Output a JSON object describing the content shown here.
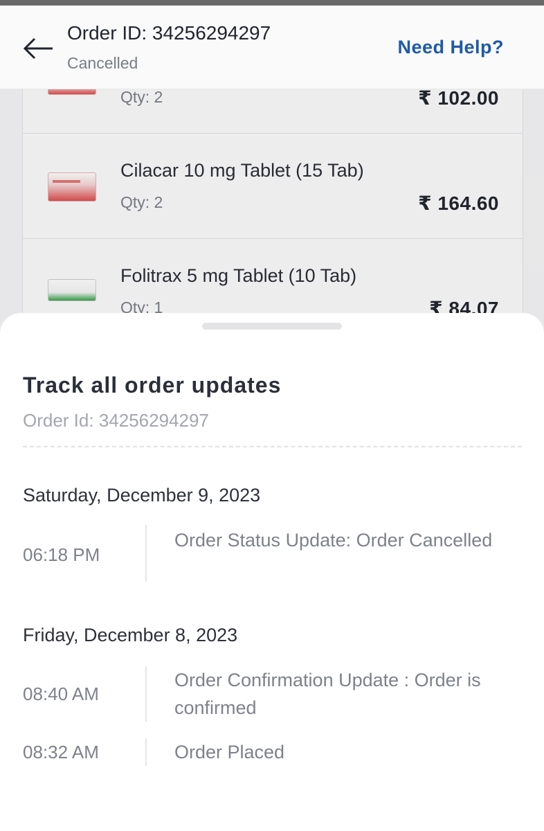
{
  "header": {
    "title": "Order ID: 34256294297",
    "status": "Cancelled",
    "help_label": "Need Help?"
  },
  "items": [
    {
      "name": "",
      "qty": "Qty: 2",
      "price": "₹ 102.00"
    },
    {
      "name": "Cilacar 10 mg Tablet (15 Tab)",
      "qty": "Qty: 2",
      "price": "₹ 164.60"
    },
    {
      "name": "Folitrax 5 mg Tablet (10 Tab)",
      "qty": "Qty: 1",
      "price": "₹ 84.07"
    }
  ],
  "sheet": {
    "title": "Track all order updates",
    "order_id": "Order Id: 34256294297",
    "groups": [
      {
        "date": "Saturday, December 9, 2023",
        "events": [
          {
            "time": "06:18 PM",
            "text": "Order Status Update:  Order Cancelled"
          }
        ]
      },
      {
        "date": "Friday, December 8, 2023",
        "events": [
          {
            "time": "08:40 AM",
            "text": "Order Confirmation Update : Order is confirmed"
          },
          {
            "time": "08:32 AM",
            "text": "Order Placed"
          }
        ]
      }
    ]
  },
  "colors": {
    "accent": "#1f5aa6",
    "text_dark": "#2a2f3a",
    "text_muted": "#7d828a"
  },
  "icons": {
    "back": "arrow-left-icon"
  }
}
